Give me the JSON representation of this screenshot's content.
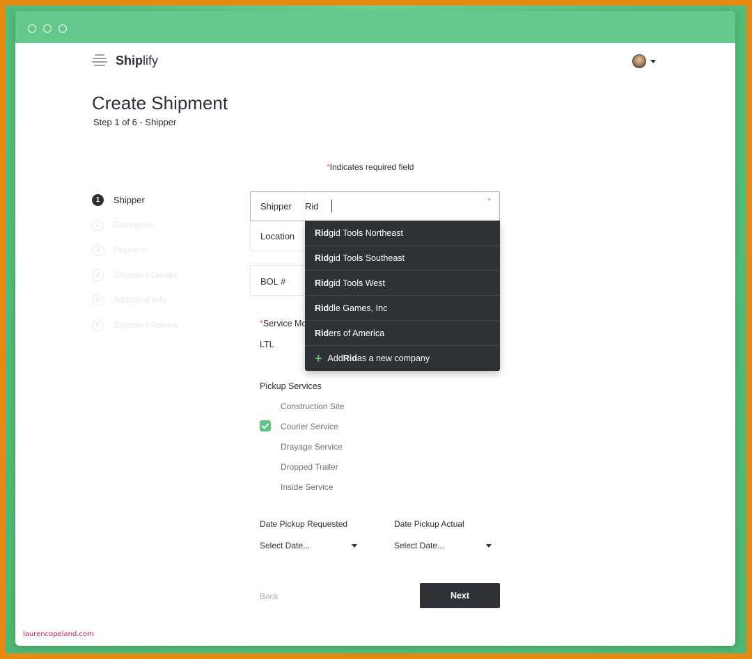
{
  "brand": {
    "name_bold": "Ship",
    "name_light": "lify"
  },
  "page": {
    "title": "Create Shipment",
    "subtitle": "Step 1 of 6 - Shipper"
  },
  "required_note": {
    "star": "*",
    "text": "Indicates required field"
  },
  "steps": [
    {
      "number": "1",
      "label": "Shipper",
      "active": true
    },
    {
      "number": "2",
      "label": "Consignee",
      "active": false
    },
    {
      "number": "3",
      "label": "Payment",
      "active": false
    },
    {
      "number": "4",
      "label": "Shipment Details",
      "active": false
    },
    {
      "number": "5",
      "label": "Additional Info",
      "active": false
    },
    {
      "number": "6",
      "label": "Shipment Review",
      "active": false
    }
  ],
  "form": {
    "shipper": {
      "label": "Shipper",
      "value": "Rid",
      "required_mark": "*"
    },
    "location": {
      "label": "Location"
    },
    "bol": {
      "label": "BOL #"
    },
    "service_mode": {
      "star": "*",
      "label": "Service Mo",
      "value": "LTL"
    },
    "pickup_services": {
      "title": "Pickup Services",
      "items": [
        {
          "label": "Construction Site",
          "checked": false
        },
        {
          "label": "Courier Service",
          "checked": true
        },
        {
          "label": "Drayage Service",
          "checked": false
        },
        {
          "label": "Dropped Trailer",
          "checked": false
        },
        {
          "label": "Inside Service",
          "checked": false
        }
      ]
    },
    "date_requested": {
      "label": "Date Pickup Requested",
      "value": "Select Date..."
    },
    "date_actual": {
      "label": "Date Pickup Actual",
      "value": "Select Date..."
    }
  },
  "autocomplete": {
    "items": [
      {
        "match": "Rid",
        "rest": "gid Tools Northeast"
      },
      {
        "match": "Rid",
        "rest": "gid Tools Southeast"
      },
      {
        "match": "Rid",
        "rest": "gid Tools West"
      },
      {
        "match": "Rid",
        "rest": "dle Games, Inc"
      },
      {
        "match": "Rid",
        "rest": "ers of America"
      }
    ],
    "add_new": {
      "prefix": "Add ",
      "match": "Rid",
      "suffix": " as a new company",
      "icon": "plus-icon"
    }
  },
  "nav": {
    "back": "Back",
    "next": "Next"
  },
  "watermark": "laurencopeland.com",
  "colors": {
    "accent": "#5cc57f",
    "titlebar": "#64c98a",
    "dark": "#2e3135",
    "frame": "#e68a12",
    "required": "#e05a5a"
  }
}
